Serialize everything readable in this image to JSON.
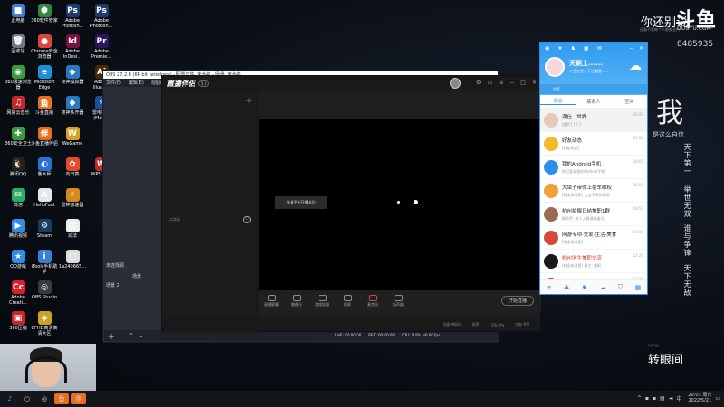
{
  "desktop_icons": [
    {
      "label": "此电脑",
      "color": "#3c7fd6",
      "glyph": "■",
      "col": 0,
      "row": 0
    },
    {
      "label": "360软件管家",
      "color": "#2e8b3a",
      "glyph": "⬢",
      "col": 1,
      "row": 0
    },
    {
      "label": "Adobe\nPhotosh...",
      "color": "#1c3c6e",
      "glyph": "Ps",
      "col": 2,
      "row": 0
    },
    {
      "label": "Adobe\nPhotosh...",
      "color": "#1c3c6e",
      "glyph": "Ps",
      "col": 3,
      "row": 0
    },
    {
      "label": "回收站",
      "color": "#6d7a86",
      "glyph": "🗑",
      "col": 0,
      "row": 1
    },
    {
      "label": "Chrome安全\n浏览器",
      "color": "#d9483b",
      "glyph": "●",
      "col": 1,
      "row": 1
    },
    {
      "label": "Adobe\nInDesi...",
      "color": "#7a1043",
      "glyph": "Id",
      "col": 2,
      "row": 1
    },
    {
      "label": "Adobe\nPremie...",
      "color": "#2a1760",
      "glyph": "Pr",
      "col": 3,
      "row": 1
    },
    {
      "label": "360极速浏览\n器",
      "color": "#3a9b3e",
      "glyph": "◉",
      "col": 0,
      "row": 2
    },
    {
      "label": "Microsoft\nEdge",
      "color": "#1f8fd6",
      "glyph": "e",
      "col": 1,
      "row": 2
    },
    {
      "label": "夜神模拟器",
      "color": "#2b78c4",
      "glyph": "◆",
      "col": 2,
      "row": 2
    },
    {
      "label": "Adobe\nIllustr...",
      "color": "#4a2a00",
      "glyph": "Ai",
      "col": 3,
      "row": 2
    },
    {
      "label": "网易云音乐",
      "color": "#c8262d",
      "glyph": "♫",
      "col": 0,
      "row": 3
    },
    {
      "label": "斗鱼直播",
      "color": "#e86d1f",
      "glyph": "鱼",
      "col": 1,
      "row": 3
    },
    {
      "label": "夜神多开器",
      "color": "#2b78c4",
      "glyph": "◆",
      "col": 2,
      "row": 3
    },
    {
      "label": "雷电模拟\n(Matlp)",
      "color": "#1b4f99",
      "glyph": "⚡",
      "col": 3,
      "row": 3
    },
    {
      "label": "360安全卫士",
      "color": "#3a9b3e",
      "glyph": "✚",
      "col": 0,
      "row": 4
    },
    {
      "label": "斗鱼直播伴侣",
      "color": "#e86d1f",
      "glyph": "伴",
      "col": 1,
      "row": 4
    },
    {
      "label": "WeGame",
      "color": "#d9a21f",
      "glyph": "W",
      "col": 2,
      "row": 4
    },
    {
      "label": "腾讯QQ",
      "color": "#222222",
      "glyph": "🐧",
      "col": 0,
      "row": 5
    },
    {
      "label": "鲁大师",
      "color": "#2a6fd6",
      "glyph": "◐",
      "col": 1,
      "row": 5
    },
    {
      "label": "向日葵",
      "color": "#e24b2d",
      "glyph": "✿",
      "col": 2,
      "row": 5
    },
    {
      "label": "WPS Of...",
      "color": "#c8262d",
      "glyph": "W",
      "col": 3,
      "row": 5
    },
    {
      "label": "微信",
      "color": "#2aae67",
      "glyph": "✉",
      "col": 0,
      "row": 6
    },
    {
      "label": "HelloFont",
      "color": "#e7e7e7",
      "glyph": "A",
      "col": 1,
      "row": 6
    },
    {
      "label": "雷神加速器",
      "color": "#d88a1f",
      "glyph": "⚡",
      "col": 2,
      "row": 6
    },
    {
      "label": "腾讯视频",
      "color": "#2d8fe8",
      "glyph": "▶",
      "col": 0,
      "row": 7
    },
    {
      "label": "Steam",
      "color": "#1a3c5e",
      "glyph": "⚙",
      "col": 1,
      "row": 7
    },
    {
      "label": "减法",
      "color": "#eeeeee",
      "glyph": "▤",
      "col": 2,
      "row": 7
    },
    {
      "label": "QQ游戏",
      "color": "#2d8fe8",
      "glyph": "★",
      "col": 0,
      "row": 8
    },
    {
      "label": "iTools手机助\n手",
      "color": "#3a7fd6",
      "glyph": "i",
      "col": 1,
      "row": 8
    },
    {
      "label": "1a240665...",
      "color": "#dddddd",
      "glyph": "▢",
      "col": 2,
      "row": 8
    },
    {
      "label": "Adobe\nCreati...",
      "color": "#da1f26",
      "glyph": "Cc",
      "col": 0,
      "row": 9
    },
    {
      "label": "OBS Studio",
      "color": "#3a3a3a",
      "glyph": "◎",
      "col": 1,
      "row": 9
    },
    {
      "label": "360压缩",
      "color": "#c8262d",
      "glyph": "▣",
      "col": 0,
      "row": 10
    },
    {
      "label": "CFHD高清高\n清大区",
      "color": "#c9a227",
      "glyph": "◈",
      "col": 1,
      "row": 10
    }
  ],
  "watermark": {
    "headline": "你还别说",
    "small": "还真不是每个人都能坚持",
    "logo": "斗鱼",
    "url": "DOUYU.COM",
    "room_id": "8485935",
    "big_char": "我",
    "sub_line": "是这么自信",
    "vertical_1": "天下第一",
    "vertical_2": "举世无双",
    "vertical_3": "谁与争锋",
    "vertical_4": "天下无敌",
    "bottom_text": "转眼间",
    "bottom_small": "时间飞逝"
  },
  "obs": {
    "title": "OBS 27.2.4 (64 bit, windows) - 配置文件: 未命名 - 场景: 未命名",
    "menu": [
      "文件(F)",
      "编辑(E)",
      "视图(V)"
    ],
    "scene_label": "未选择源",
    "scene_tab": "场景",
    "scene_item": "场景 2",
    "stats": [
      "LIVE: 00:00:00",
      "REC: 00:00:00",
      "CPU: 0.4%, 60.00 fps"
    ]
  },
  "app": {
    "logo": "直播伴侣",
    "version": "5.0",
    "scene_label": "二次元",
    "preview_toast": "头像平台开播成功",
    "toolbar": [
      "直播屏幕",
      "摄像头",
      "游戏投屏",
      "投屏",
      "麦克风",
      "扬声器"
    ],
    "start_button": "开始直播",
    "status": [
      "网速:0KB/s",
      "帧率",
      "CPU:0%",
      "内存:0%"
    ]
  },
  "qq": {
    "name": "天朝上......",
    "signature": "人生在世，不过就是......",
    "search_placeholder": "搜索",
    "tabs": [
      "消息",
      "联系人",
      "空间"
    ],
    "items": [
      {
        "title": "潮仕...世界",
        "sub": "[图片] ? ? ?",
        "time": "20:02",
        "avatar": "#e8c9b8",
        "red": false
      },
      {
        "title": "好友动态",
        "sub": "[好友动态]",
        "time": "20:02",
        "avatar": "#f7b92a",
        "red": false
      },
      {
        "title": "我的Android手机",
        "sub": "你已登录我的Android手机",
        "time": "20:01",
        "avatar": "#2d8fe8",
        "red": false
      },
      {
        "title": "大虫子带你上豪车维权",
        "sub": "[有全体消息] 大虫子带你维权",
        "time": "20:01",
        "avatar": "#f0a13a",
        "red": false
      },
      {
        "title": "杭州拍摄日结兼职1群",
        "sub": "群助手: 新人入群请改备注",
        "time": "19:52",
        "avatar": "#9a6b4e",
        "red": false
      },
      {
        "title": "网游专项·交友·生活·美食",
        "sub": "[有全体消息]",
        "time": "19:04",
        "avatar": "#d44a3a",
        "red": false
      },
      {
        "title": "杭州学生兼职交流",
        "sub": "[有全体消息] 群主: 兼职",
        "time": "12:20",
        "avatar": "#1a1a1a",
        "red": true
      },
      {
        "title": "斗鱼OBS兼职Excel群",
        "sub": "[有全体消息]",
        "time": "11:40",
        "avatar": "#c43a2a",
        "red": true
      }
    ],
    "footer_icons": [
      "menu-icon",
      "app-icon",
      "game-icon",
      "cloud-icon",
      "shield-icon",
      "app-store-icon"
    ]
  },
  "taskbar": {
    "items": [
      "qq-icon",
      "search-icon",
      "obs-icon",
      "douyu-icon",
      "douyu-companion-icon"
    ],
    "time": "20:03 周六",
    "date": "2022/5/21"
  }
}
